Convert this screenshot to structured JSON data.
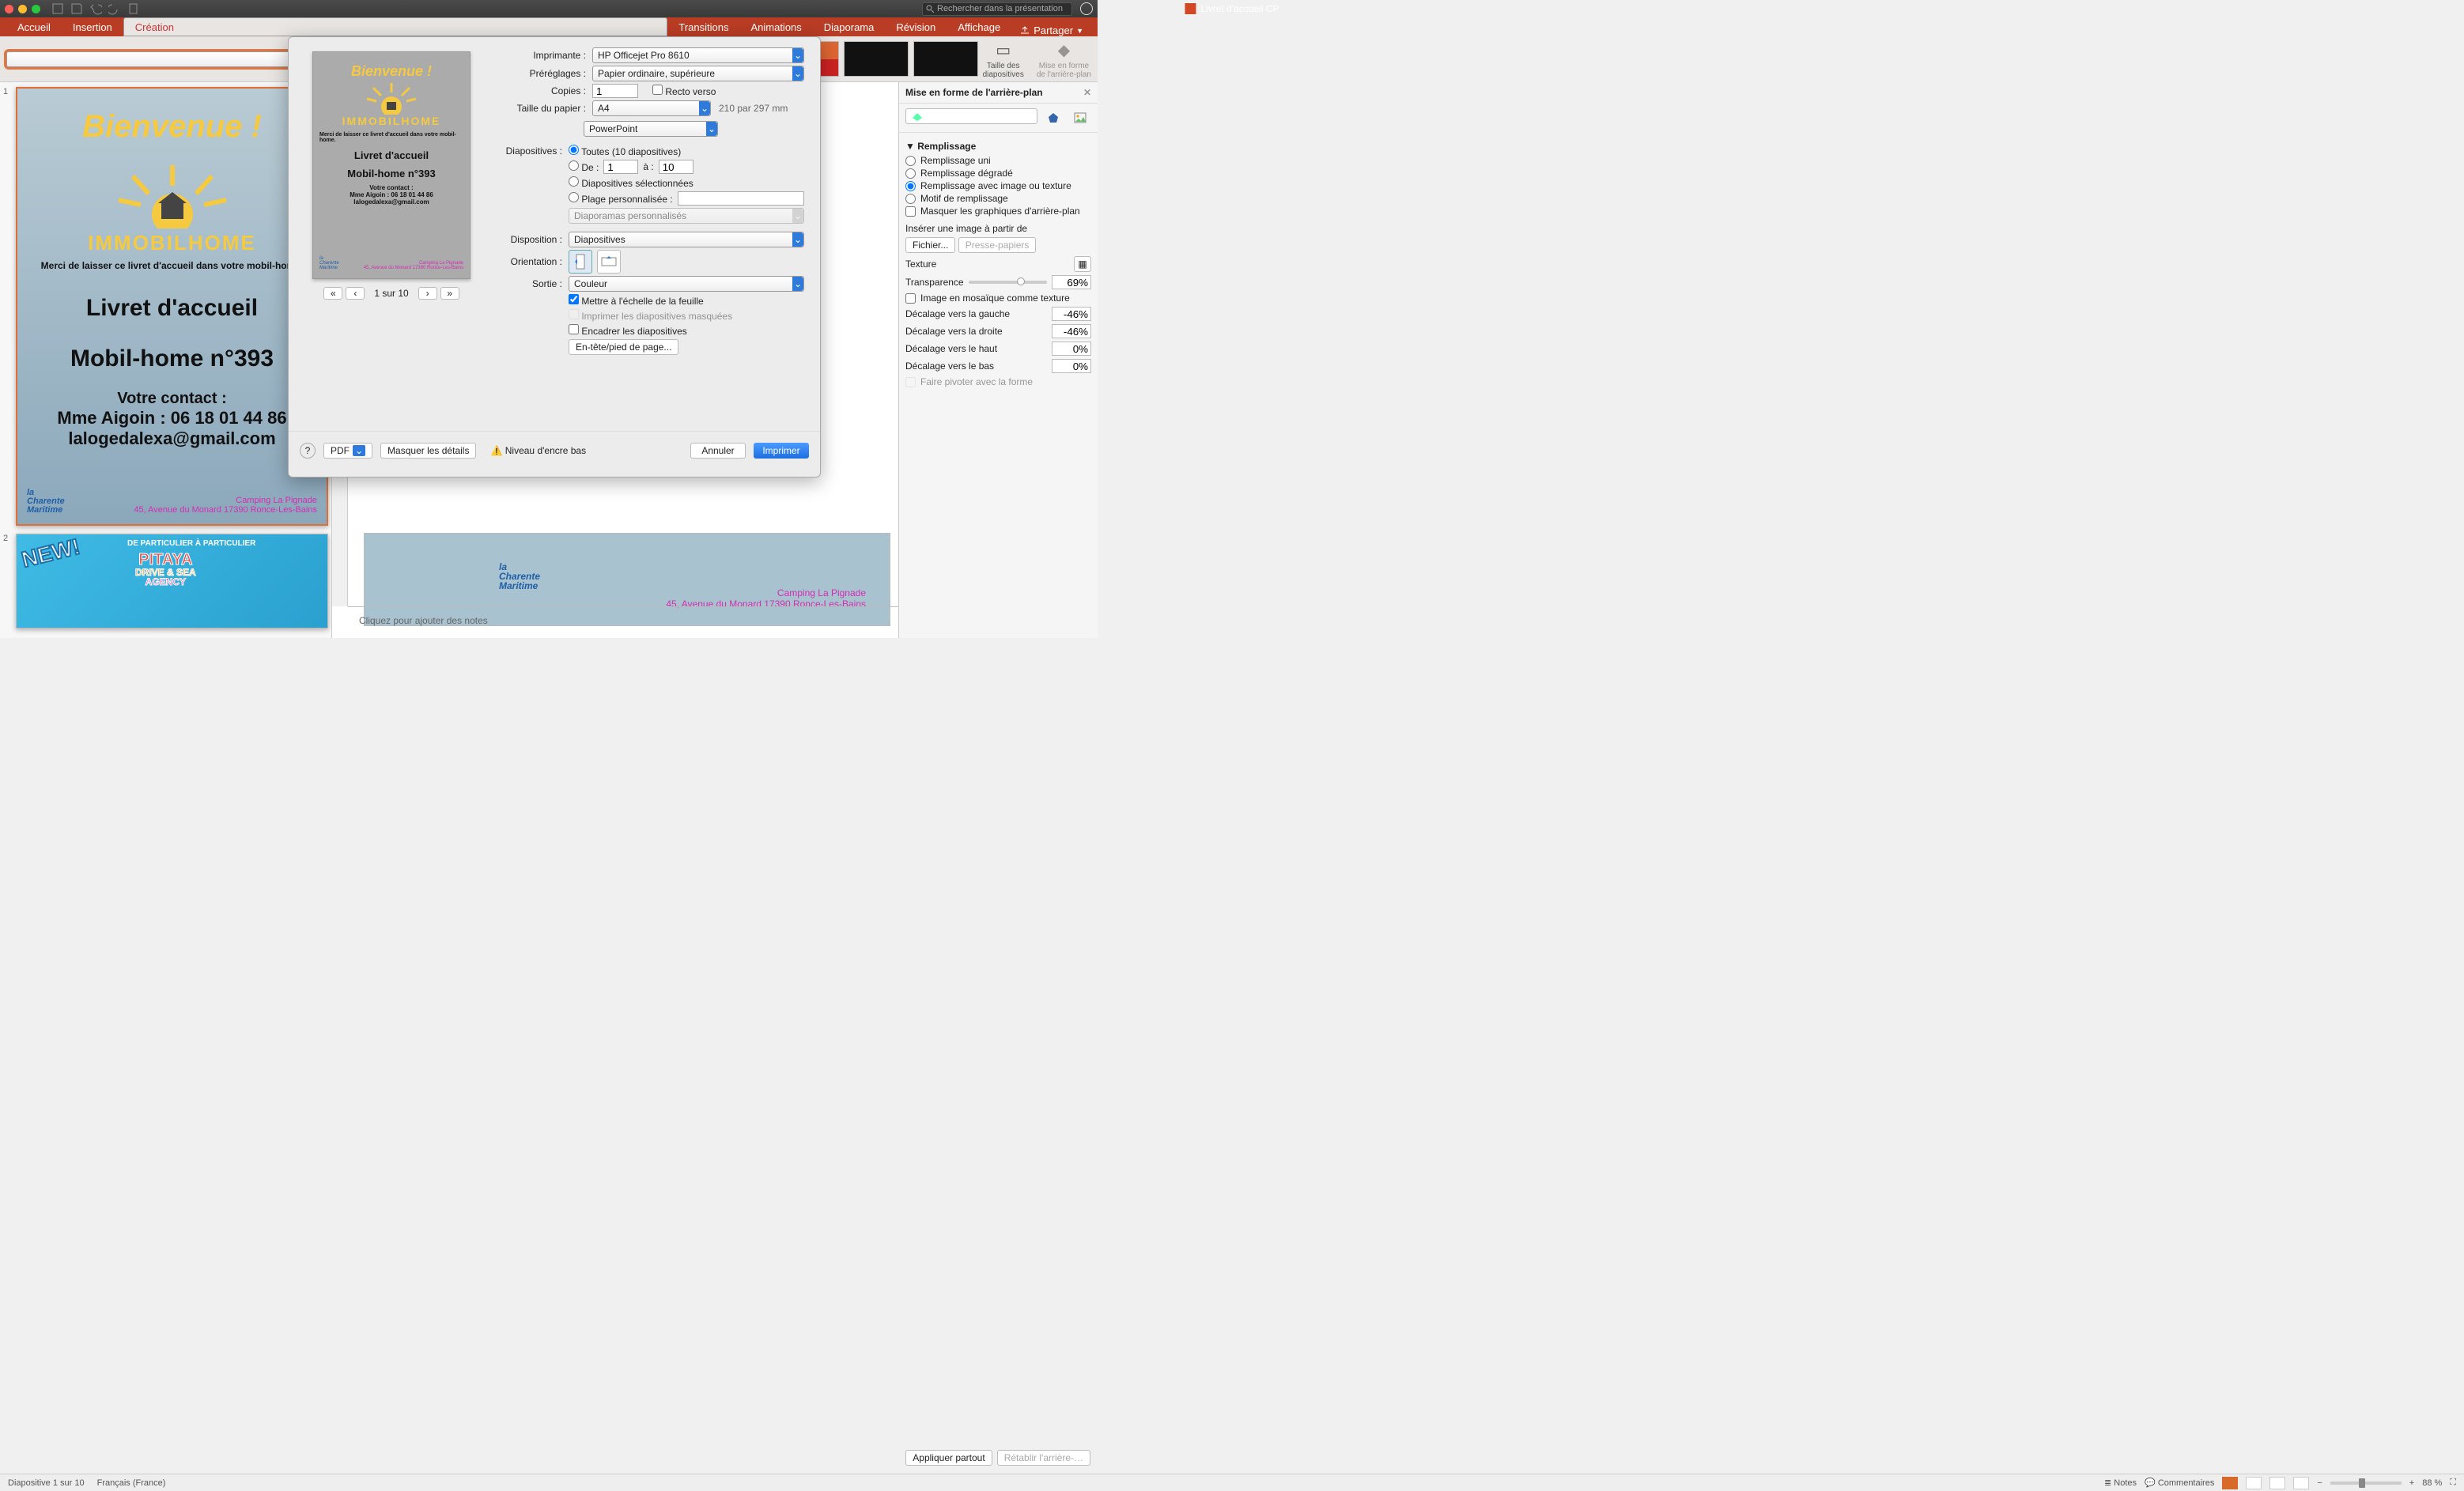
{
  "title": "Livret d'accueil CP",
  "search_placeholder": "Rechercher dans la présentation",
  "ribbon_tabs": [
    "Accueil",
    "Insertion",
    "Création",
    "Transitions",
    "Animations",
    "Diaporama",
    "Révision",
    "Affichage"
  ],
  "ribbon_active": 2,
  "share_label": "Partager",
  "ribbon_right": {
    "a": "Taille des\ndiapositives",
    "b": "Mise en forme\nde l'arrière-plan"
  },
  "slide": {
    "bienvenue": "Bienvenue !",
    "logo": "IMMOBILHOME",
    "leave": "Merci de laisser ce livret d'accueil dans votre mobil-home.",
    "t1": "Livret d'accueil",
    "t2": "Mobil-home n°393",
    "contact_hd": "Votre contact :",
    "contact_line": "Mme Aigoin : 06 18 01 44 86",
    "email": "lalogedalexa@gmail.com",
    "cm_brand": "la\nCharente\nMaritime",
    "camp_name": "Camping La Pignade",
    "camp_addr": "45, Avenue du Monard 17390 Ronce-Les-Bains"
  },
  "slide2_banner": "DE PARTICULIER À PARTICULIER",
  "slide2_brand_lines": [
    "PITAYA",
    "DRIVE & SEA",
    "AGENCY"
  ],
  "slide2_new": "NEW!",
  "preview_counter": "1 sur 10",
  "print": {
    "labels": {
      "printer": "Imprimante :",
      "presets": "Préréglages :",
      "copies": "Copies :",
      "recto": "Recto verso",
      "paper": "Taille du papier :",
      "paper_dim": "210 par 297 mm",
      "app_sel": "PowerPoint",
      "slides": "Diapositives :",
      "all": "Toutes  (10 diapositives)",
      "from": "De :",
      "to": "à :",
      "selected": "Diapositives sélectionnées",
      "custom_range": "Plage personnalisée :",
      "custom_shows": "Diaporamas personnalisés",
      "layout": "Disposition :",
      "orientation": "Orientation :",
      "output": "Sortie :",
      "scale": "Mettre à l'échelle de la feuille",
      "hidden": "Imprimer les diapositives masquées",
      "frame": "Encadrer les diapositives",
      "header_btn": "En-tête/pied de page...",
      "help": "?",
      "pdf": "PDF",
      "hide_details": "Masquer les détails",
      "ink": "Niveau d'encre bas",
      "cancel": "Annuler",
      "print": "Imprimer"
    },
    "values": {
      "printer": "HP Officejet Pro 8610",
      "preset": "Papier ordinaire, supérieure",
      "copies": "1",
      "paper": "A4",
      "from": "1",
      "to": "10",
      "layout": "Diapositives",
      "output": "Couleur"
    }
  },
  "format": {
    "title": "Mise en forme de l'arrière-plan",
    "section": "Remplissage",
    "opts": {
      "solid": "Remplissage uni",
      "grad": "Remplissage dégradé",
      "pic": "Remplissage avec image ou texture",
      "pat": "Motif de remplissage",
      "hide": "Masquer les graphiques d'arrière-plan"
    },
    "insert_lbl": "Insérer une image à partir de",
    "file_btn": "Fichier...",
    "clip_btn": "Presse-papiers",
    "texture": "Texture",
    "transparency": "Transparence",
    "transparency_v": "69%",
    "tile": "Image en mosaïque comme texture",
    "off_l": "Décalage vers la gauche",
    "off_l_v": "-46%",
    "off_r": "Décalage vers la droite",
    "off_r_v": "-46%",
    "off_t": "Décalage vers le haut",
    "off_t_v": "0%",
    "off_b": "Décalage vers le bas",
    "off_b_v": "0%",
    "rotate": "Faire pivoter avec la forme",
    "apply_all": "Appliquer partout",
    "reset": "Rétablir l'arrière-…"
  },
  "notes_placeholder": "Cliquez pour ajouter des notes",
  "status": {
    "slide": "Diapositive 1 sur 10",
    "lang": "Français (France)",
    "notes": "Notes",
    "comments": "Commentaires",
    "zoom": "88 %"
  },
  "chart_data": null
}
